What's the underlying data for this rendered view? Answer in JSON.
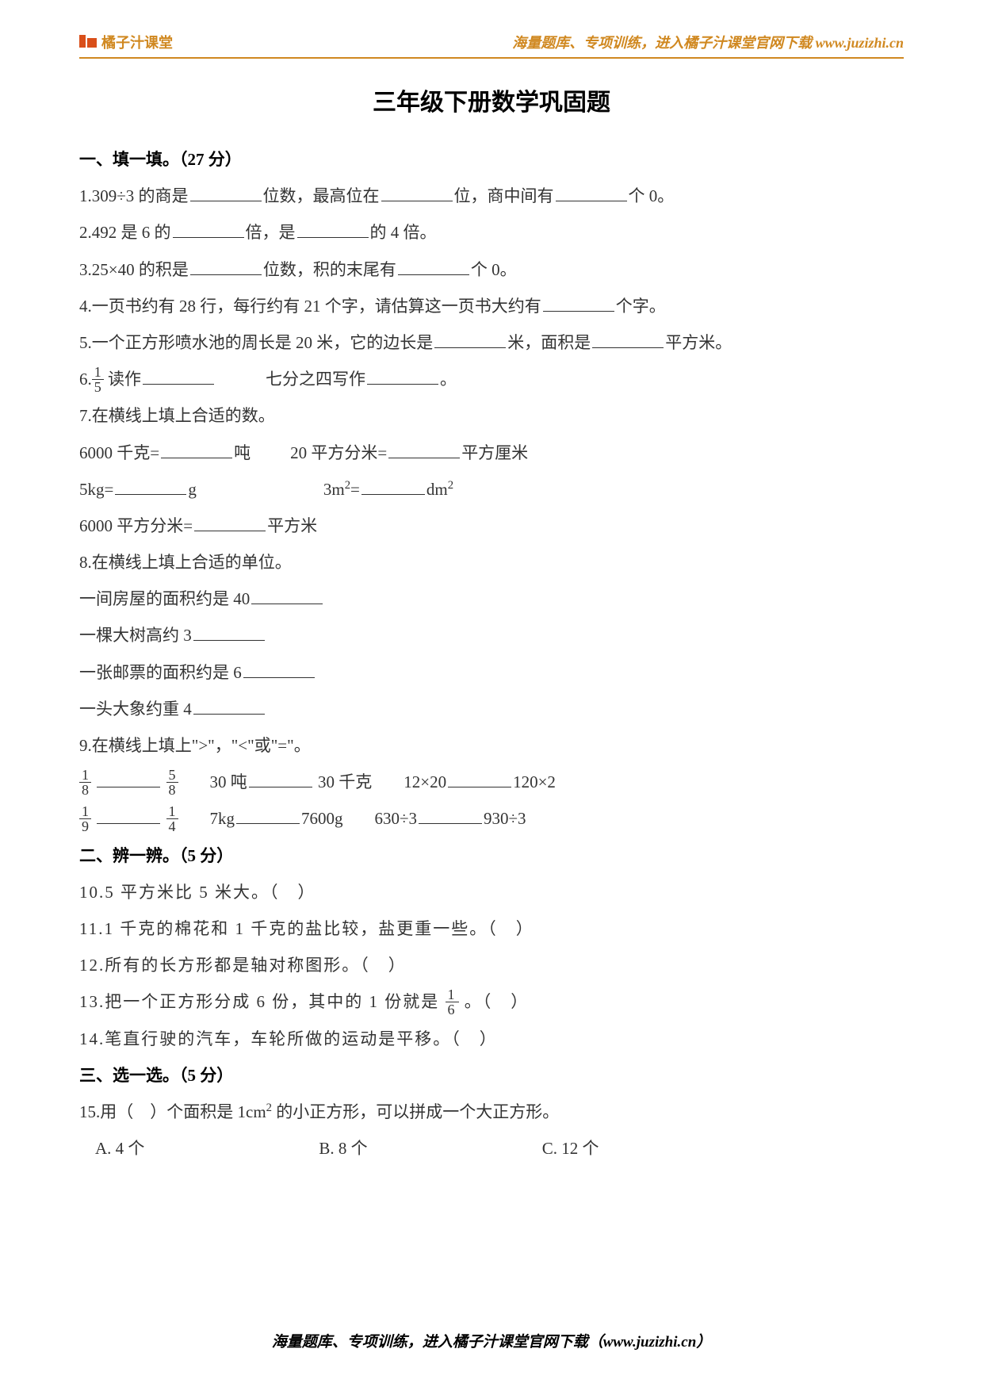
{
  "header": {
    "logo_text": "橘子汁课堂",
    "right_text": "海量题库、专项训练，进入橘子汁课堂官网下载 www.juzizhi.cn"
  },
  "title": "三年级下册数学巩固题",
  "sections": {
    "s1": {
      "head": "一、填一填。（27 分）",
      "q1_a": "1.309÷3 的商是",
      "q1_b": "位数，最高位在",
      "q1_c": "位，商中间有",
      "q1_d": "个 0。",
      "q2_a": "2.492 是 6 的",
      "q2_b": "倍，是",
      "q2_c": "的 4 倍。",
      "q3_a": "3.25×40 的积是",
      "q3_b": "位数，积的末尾有",
      "q3_c": "个 0。",
      "q4_a": "4.一页书约有 28 行，每行约有 21 个字，请估算这一页书大约有",
      "q4_b": "个字。",
      "q5_a": "5.一个正方形喷水池的周长是 20 米，它的边长是",
      "q5_b": "米，面积是",
      "q5_c": "平方米。",
      "q6_a": "6.",
      "q6_frac_num": "1",
      "q6_frac_den": "5",
      "q6_b": " 读作",
      "q6_c": "七分之四写作",
      "q6_d": "。",
      "q7": "7.在横线上填上合适的数。",
      "q7_1a": "6000 千克=",
      "q7_1b": "吨",
      "q7_2a": "20 平方分米=",
      "q7_2b": "平方厘米",
      "q7_3a": "5kg=",
      "q7_3b": "g",
      "q7_4a": "3m",
      "q7_4b": "=",
      "q7_4c": "dm",
      "q7_5a": "6000 平方分米=",
      "q7_5b": "平方米",
      "q8": "8.在横线上填上合适的单位。",
      "q8_1": "一间房屋的面积约是 40",
      "q8_2": "一棵大树高约 3",
      "q8_3": "一张邮票的面积约是 6",
      "q8_4": "一头大象约重 4",
      "q9": "9.在横线上填上\">\"，\"<\"或\"=\"。",
      "q9_r1_f1n": "1",
      "q9_r1_f1d": "8",
      "q9_r1_f2n": "5",
      "q9_r1_f2d": "8",
      "q9_r1_b": "30 吨",
      "q9_r1_c": "30 千克",
      "q9_r1_d": "12×20",
      "q9_r1_e": "120×2",
      "q9_r2_f1n": "1",
      "q9_r2_f1d": "9",
      "q9_r2_f2n": "1",
      "q9_r2_f2d": "4",
      "q9_r2_b": "7kg",
      "q9_r2_c": "7600g",
      "q9_r2_d": "630÷3",
      "q9_r2_e": "930÷3"
    },
    "s2": {
      "head": "二、辨一辨。（5 分）",
      "q10": "10.5 平方米比 5 米大。（　）",
      "q11": "11.1 千克的棉花和 1 千克的盐比较，盐更重一些。（　）",
      "q12": "12.所有的长方形都是轴对称图形。（　）",
      "q13_a": "13.把一个正方形分成 6 份，其中的 1 份就是 ",
      "q13_fn": "1",
      "q13_fd": "6",
      "q13_b": " 。（　）",
      "q14": "14.笔直行驶的汽车，车轮所做的运动是平移。（　）"
    },
    "s3": {
      "head": "三、选一选。（5 分）",
      "q15_a": "15.用（　）个面积是 1cm",
      "q15_b": " 的小正方形，可以拼成一个大正方形。",
      "opt_a": "A. 4 个",
      "opt_b": "B. 8 个",
      "opt_c": "C. 12 个"
    }
  },
  "footer": "海量题库、专项训练，进入橘子汁课堂官网下载（www.juzizhi.cn）"
}
